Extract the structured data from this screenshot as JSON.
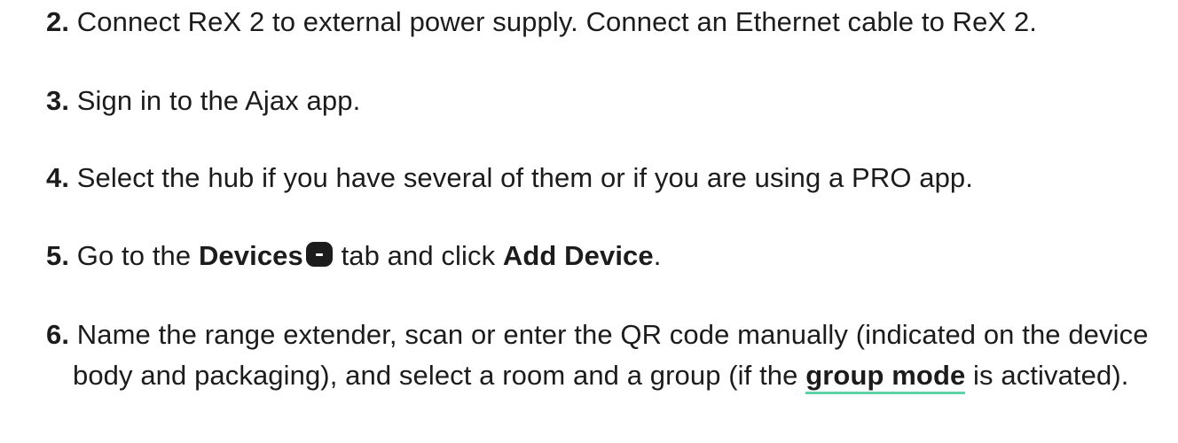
{
  "steps": {
    "s2": {
      "num": "2.",
      "text": "Connect ReX 2 to external power supply. Connect an Ethernet cable to ReX 2."
    },
    "s3": {
      "num": "3.",
      "text": "Sign in to the Ajax app."
    },
    "s4": {
      "num": "4.",
      "text": "Select the hub if you have several of them or if you are using a PRO app."
    },
    "s5": {
      "num": "5.",
      "pre": "Go to the",
      "tab_name": "Devices",
      "icon": "devices-tab-icon",
      "mid": "tab and click",
      "action": "Add Device",
      "end": "."
    },
    "s6": {
      "num": "6.",
      "text_before_link": "Name the range extender, scan or enter the QR code manually (indicated on the device body and packaging), and select a room and a group (if the",
      "link": "group mode",
      "text_after_link": "is activated)."
    }
  },
  "colors": {
    "text": "#1c1c1c",
    "link_underline": "#5fd3a7"
  }
}
